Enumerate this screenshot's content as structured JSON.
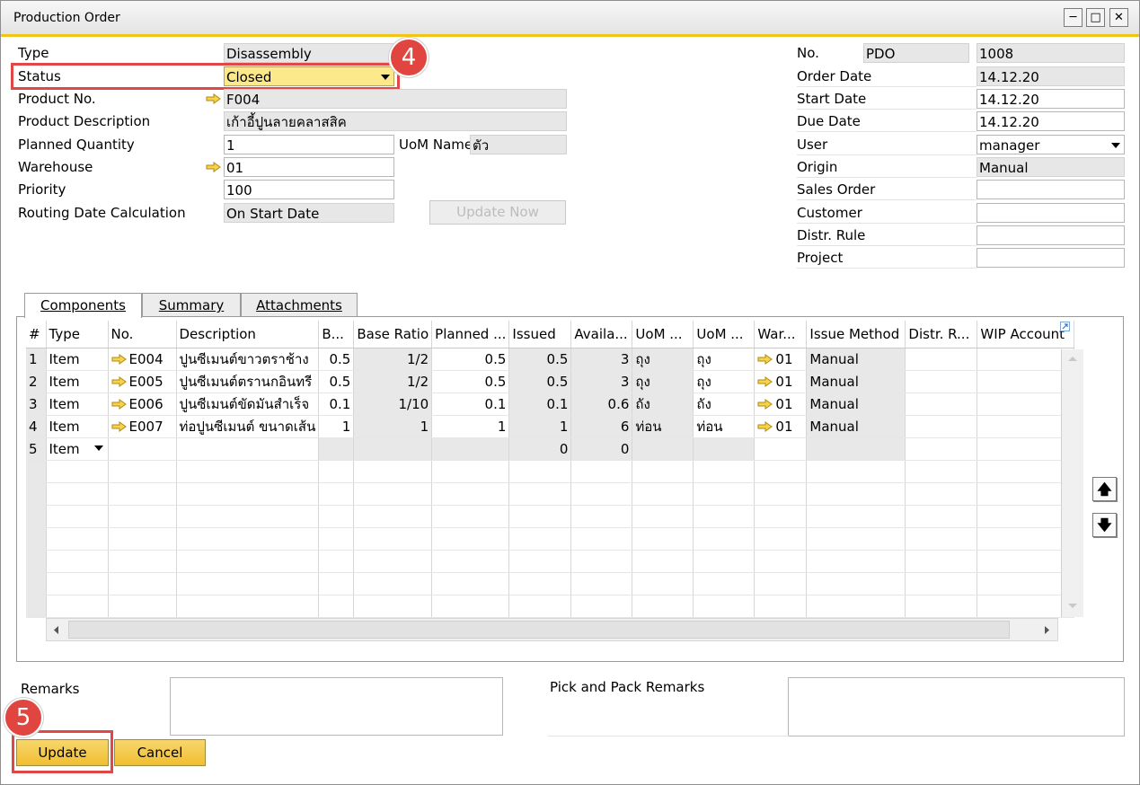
{
  "window": {
    "title": "Production Order"
  },
  "colors": {
    "accent": "#f0c419",
    "highlight": "#e04848",
    "button": "#f2c43e"
  },
  "header_left": {
    "type": {
      "label": "Type",
      "value": "Disassembly"
    },
    "status": {
      "label": "Status",
      "value": "Closed"
    },
    "product_no": {
      "label": "Product No.",
      "value": "F004"
    },
    "product_description": {
      "label": "Product Description",
      "value": "เก้าอี้ปูนลายคลาสสิค"
    },
    "planned_quantity": {
      "label": "Planned Quantity",
      "value": "1"
    },
    "uom_name": {
      "label": "UoM Name",
      "value": "ตัว"
    },
    "warehouse": {
      "label": "Warehouse",
      "value": "01"
    },
    "priority": {
      "label": "Priority",
      "value": "100"
    },
    "routing_date_calc": {
      "label": "Routing Date Calculation",
      "value": "On Start Date"
    },
    "update_now_label": "Update Now"
  },
  "header_right": {
    "no": {
      "label": "No.",
      "series": "PDO",
      "value": "1008"
    },
    "order_date": {
      "label": "Order Date",
      "value": "14.12.20"
    },
    "start_date": {
      "label": "Start Date",
      "value": "14.12.20"
    },
    "due_date": {
      "label": "Due Date",
      "value": "14.12.20"
    },
    "user": {
      "label": "User",
      "value": "manager"
    },
    "origin": {
      "label": "Origin",
      "value": "Manual"
    },
    "sales_order": {
      "label": "Sales Order",
      "value": ""
    },
    "customer": {
      "label": "Customer",
      "value": ""
    },
    "distr_rule": {
      "label": "Distr. Rule",
      "value": ""
    },
    "project": {
      "label": "Project",
      "value": ""
    }
  },
  "tabs": [
    {
      "label": "Components"
    },
    {
      "label": "Summary"
    },
    {
      "label": "Attachments"
    }
  ],
  "grid": {
    "columns": [
      "#",
      "Type",
      "No.",
      "Description",
      "B...",
      "Base Ratio",
      "Planned ...",
      "Issued",
      "Availa...",
      "UoM ...",
      "UoM ...",
      "War...",
      "Issue Method",
      "Distr. R...",
      "WIP Account"
    ],
    "rows": [
      {
        "n": "1",
        "type": "Item",
        "no": "E004",
        "desc": "ปูนซีเมนต์ขาวตราช้าง",
        "b": "0.5",
        "ratio": "1/2",
        "planned": "0.5",
        "issued": "0.5",
        "avail": "3",
        "uom1": "ถุง",
        "uom2": "ถุง",
        "wh": "01",
        "method": "Manual"
      },
      {
        "n": "2",
        "type": "Item",
        "no": "E005",
        "desc": "ปูนซีเมนต์ตรานกอินทรี",
        "b": "0.5",
        "ratio": "1/2",
        "planned": "0.5",
        "issued": "0.5",
        "avail": "3",
        "uom1": "ถุง",
        "uom2": "ถุง",
        "wh": "01",
        "method": "Manual"
      },
      {
        "n": "3",
        "type": "Item",
        "no": "E006",
        "desc": "ปูนซีเมนต์ขัดมันสำเร็จ",
        "b": "0.1",
        "ratio": "1/10",
        "planned": "0.1",
        "issued": "0.1",
        "avail": "0.6",
        "uom1": "ถัง",
        "uom2": "ถัง",
        "wh": "01",
        "method": "Manual"
      },
      {
        "n": "4",
        "type": "Item",
        "no": "E007",
        "desc": "ท่อปูนซีเมนต์ ขนาดเส้น",
        "b": "1",
        "ratio": "1",
        "planned": "1",
        "issued": "1",
        "avail": "6",
        "uom1": "ท่อน",
        "uom2": "ท่อน",
        "wh": "01",
        "method": "Manual"
      }
    ],
    "new_row": {
      "n": "5",
      "type": "Item",
      "issued": "0",
      "avail": "0"
    }
  },
  "footer": {
    "remarks_label": "Remarks",
    "pick_pack_label": "Pick and Pack Remarks",
    "update_label": "Update",
    "cancel_label": "Cancel"
  },
  "annotations": {
    "step4": "4",
    "step5": "5"
  }
}
